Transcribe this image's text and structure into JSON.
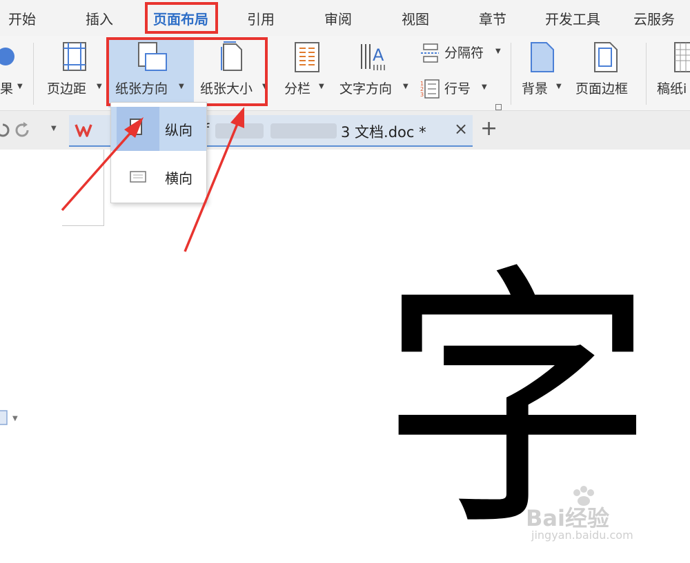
{
  "menu": {
    "tabs": [
      "开始",
      "插入",
      "页面布局",
      "引用",
      "审阅",
      "视图",
      "章节",
      "开发工具",
      "云服务"
    ],
    "active_tab": "页面布局"
  },
  "ribbon": {
    "effects_partial": "果",
    "margins": "页边距",
    "orientation": "纸张方向",
    "size": "纸张大小",
    "columns": "分栏",
    "text_direction": "文字方向",
    "breaks": "分隔符",
    "line_numbers": "行号",
    "background": "背景",
    "page_border": "页面边框",
    "manuscript_partial": "稿纸i"
  },
  "orientation_menu": {
    "items": [
      "纵向",
      "横向"
    ],
    "selected": "纵向"
  },
  "doc_tab": {
    "title_visible": "3 文档.doc *",
    "title_prefix_partial": "sof",
    "close_glyph": "×",
    "new_tab_glyph": "+"
  },
  "document": {
    "big_character": "字"
  },
  "watermark": {
    "brand": "Bai经验",
    "url": "jingyan.baidu.com"
  },
  "colors": {
    "accent": "#2f6fc7",
    "highlight_red": "#e8342f",
    "pressed_blue": "#c5d9f1"
  }
}
